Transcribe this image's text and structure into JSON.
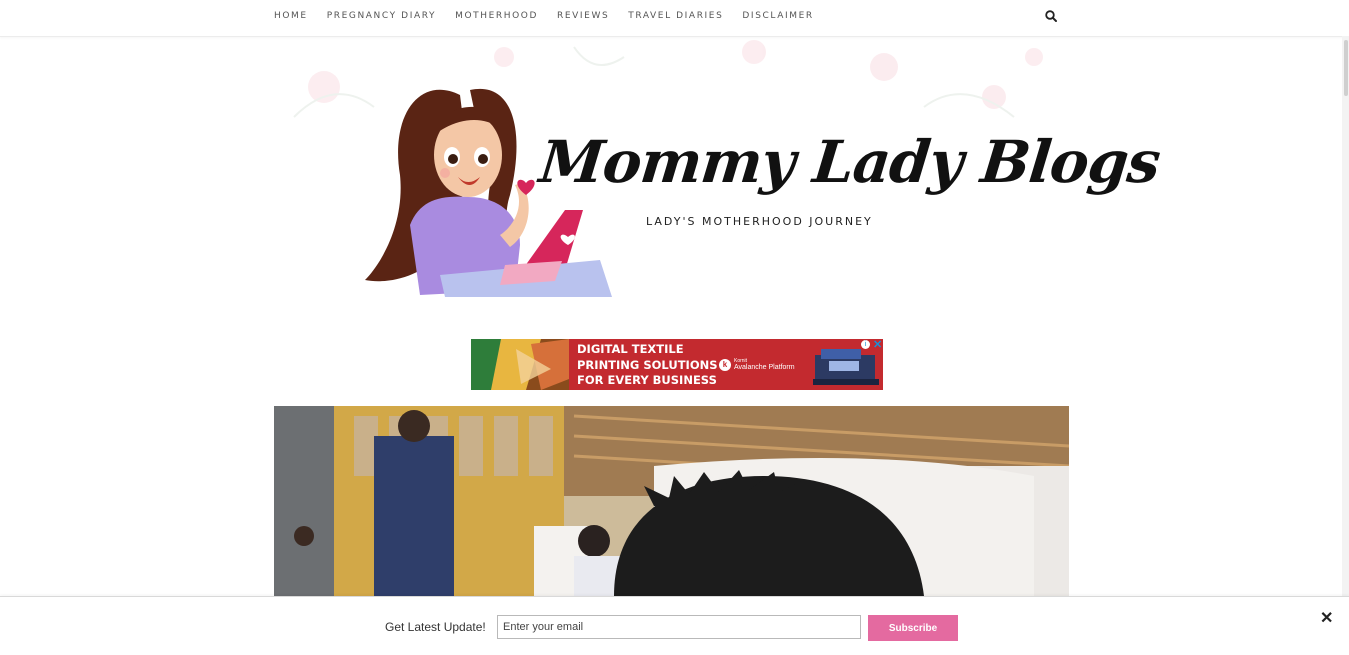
{
  "nav": {
    "items": [
      "HOME",
      "PREGNANCY DIARY",
      "MOTHERHOOD",
      "REVIEWS",
      "TRAVEL DIARIES",
      "DISCLAIMER"
    ],
    "search_icon": "search-icon"
  },
  "header": {
    "title": "Mommy Lady Blogs",
    "tagline": "LADY'S MOTHERHOOD JOURNEY"
  },
  "ad": {
    "lines": [
      "DIGITAL TEXTILE",
      "PRINTING SOLUTIONS",
      "FOR EVERY BUSINESS"
    ],
    "brand_name": "Kornit",
    "brand_product": "Avalanche Platform",
    "info_icon": "info-icon",
    "close_icon": "close-icon"
  },
  "subscribe": {
    "label": "Get Latest Update!",
    "placeholder": "Enter your email",
    "button": "Subscribe",
    "close": "✕"
  },
  "colors": {
    "accent_pink": "#e46aa0",
    "ad_red": "#c32a2f",
    "nav_text": "#555555"
  }
}
